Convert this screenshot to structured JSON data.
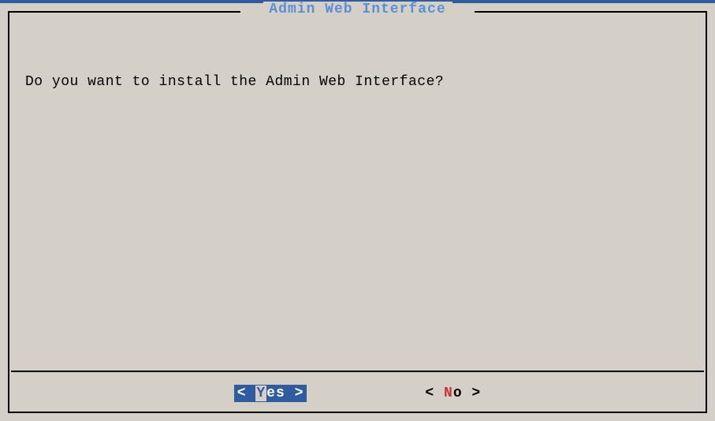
{
  "dialog": {
    "title": "Admin Web Interface",
    "question": "Do you want to install the Admin Web Interface?"
  },
  "buttons": {
    "yes": {
      "left_bracket": "< ",
      "hotkey": "Y",
      "rest": "es",
      "right_bracket": " >"
    },
    "no": {
      "left_bracket": "<  ",
      "hotkey": "N",
      "rest": "o",
      "right_bracket": "  >"
    }
  }
}
